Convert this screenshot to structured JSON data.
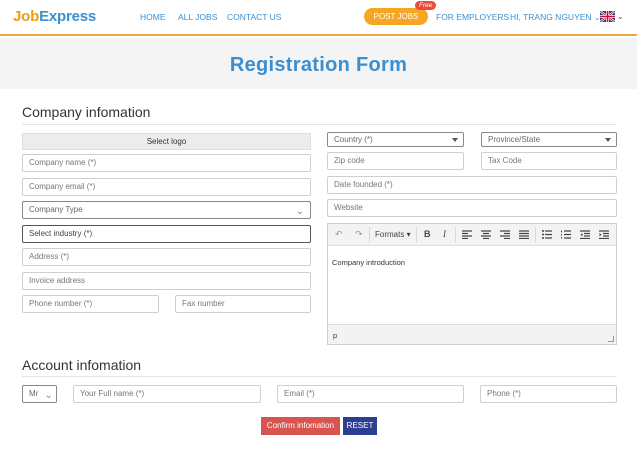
{
  "header": {
    "logo_job": "Job",
    "logo_express": "Express",
    "nav": [
      "HOME",
      "ALL JOBS",
      "CONTACT US"
    ],
    "post_jobs": "POST JOBS",
    "free_badge": "Free",
    "for_employers": "FOR EMPLOYERS",
    "user_menu": "HI, TRANG NGUYEN",
    "chevron": "⌄"
  },
  "page": {
    "title": "Registration Form"
  },
  "company": {
    "section_title": "Company infomation",
    "select_logo": "Select logo",
    "company_name": "Company name (*)",
    "company_email": "Company email (*)",
    "company_type": "Company Type",
    "select_industry": "Select industry (*)",
    "address": "Address (*)",
    "invoice_address": "Invoice address",
    "phone_number": "Phone number (*)",
    "fax_number": "Fax number",
    "country": "Country (*)",
    "province": "Province/State",
    "zip_code": "Zip code",
    "tax_code": "Tax Code",
    "date_founded": "Date founded (*)",
    "website": "Website",
    "editor": {
      "formats": "Formats",
      "content": "Company introduction",
      "status": "p"
    }
  },
  "account": {
    "section_title": "Account infomation",
    "title_select": "Mr",
    "full_name": "Your Full name (*)",
    "email": "Email (*)",
    "phone": "Phone (*)"
  },
  "actions": {
    "confirm": "Confirm infomation",
    "reset": "RESET"
  },
  "colors": {
    "accent_blue": "#3a8fd1",
    "accent_orange": "#f5a623",
    "confirm_red": "#d9534f",
    "reset_navy": "#2c3e91"
  }
}
